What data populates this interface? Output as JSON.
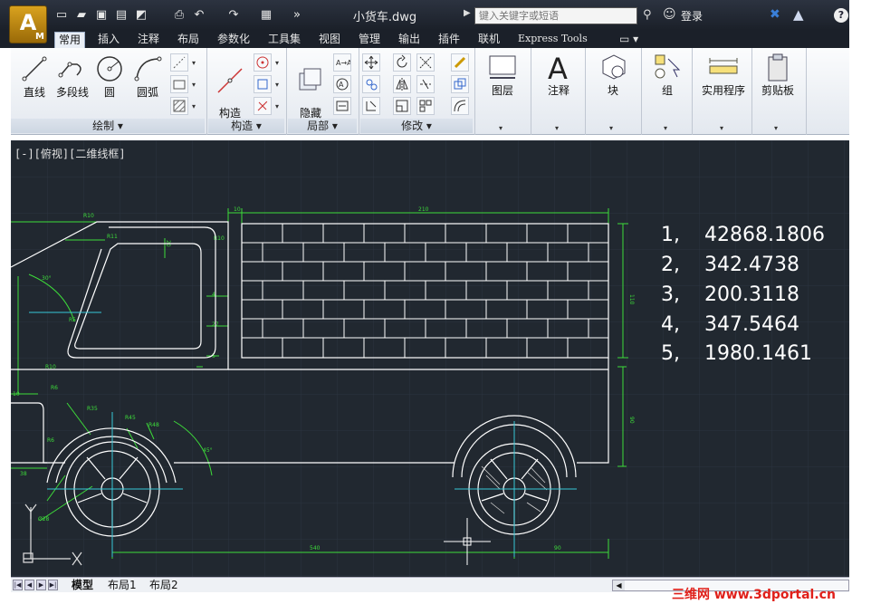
{
  "app": {
    "logo_letter": "A",
    "logo_sub": "M",
    "document_title": "小货车.dwg",
    "search_placeholder": "键入关键字或短语",
    "login_label": "登录"
  },
  "tabs": [
    "常用",
    "插入",
    "注释",
    "布局",
    "参数化",
    "工具集",
    "视图",
    "管理",
    "输出",
    "插件",
    "联机",
    "Express Tools"
  ],
  "active_tab": "常用",
  "ribbon": {
    "draw": {
      "title": "绘制 ▾",
      "buttons": [
        "直线",
        "多段线",
        "圆",
        "圆弧"
      ]
    },
    "construct": {
      "title": "构造 ▾",
      "button": "构造\n线"
    },
    "local": {
      "title": "局部 ▾",
      "button": "隐藏\n位置"
    },
    "modify": {
      "title": "修改 ▾"
    },
    "groups": [
      "图层",
      "注释",
      "块",
      "组",
      "实用程序",
      "剪贴板"
    ]
  },
  "viewport": {
    "label": "[-][俯视][二维线框]"
  },
  "results": [
    {
      "index": "1,",
      "value": "42868.1806"
    },
    {
      "index": "2,",
      "value": "342.4738"
    },
    {
      "index": "3,",
      "value": "200.3118"
    },
    {
      "index": "4,",
      "value": "347.5464"
    },
    {
      "index": "5,",
      "value": "1980.1461"
    }
  ],
  "layout_tabs": [
    "模型",
    "布局1",
    "布局2"
  ],
  "active_layout_tab": "模型",
  "watermark": "三维网 www.3dportal.cn",
  "colors": {
    "canvas_bg": "#212830",
    "dimension_green": "#3ddc3a",
    "geometry_white": "#ffffff",
    "center_cyan": "#38c8d8",
    "watermark_red": "#e0201a"
  }
}
